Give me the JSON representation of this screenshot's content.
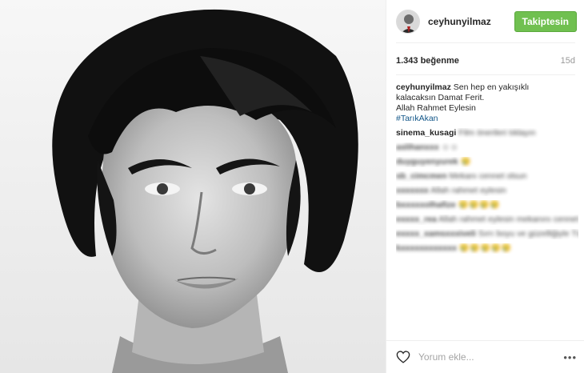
{
  "post": {
    "username": "ceyhunyilmaz",
    "follow_label": "Takiptesin",
    "likes": "1.343 beğenme",
    "time_ago": "15d"
  },
  "caption": {
    "username": "ceyhunyilmaz",
    "line1": "Sen hep en yakışıklı",
    "line2": "kalacaksın Damat Ferit.",
    "line3": "Allah Rahmet Eylesin",
    "hashtag": "#TarıkAkan"
  },
  "comments": [
    {
      "user": "sinema_kusagi",
      "text": "Film önerileri tıklayın"
    },
    {
      "user": "aslihanxxx",
      "text": "☺☺"
    },
    {
      "user": "duyguyenyurek",
      "text": "😢"
    },
    {
      "user": "sb_cimcmen",
      "text": "Mekanı cennet olsun"
    },
    {
      "user": "xxxxxxx",
      "text": "Allah rahmet eylesin"
    },
    {
      "user": "bxxxxxolhafize",
      "text": "😢😢😢😢"
    },
    {
      "user": "exxxx_rea",
      "text": "Allah rahmet eylesin mekanını cennet olsun"
    },
    {
      "user": "exxxx_xamsxxxiveli",
      "text": "Sırrı boyu ve güzelliğiyle Türk filmlerinin güzel oyuncusu"
    },
    {
      "user": "kxxxxxxxxxxxx",
      "text": "😢😢😢😢😢"
    }
  ],
  "comment_box": {
    "placeholder": "Yorum ekle..."
  },
  "icons": {
    "heart": "heart-icon",
    "more": "more-options-icon"
  },
  "colors": {
    "follow_button": "#70c050",
    "hashtag": "#125688"
  }
}
